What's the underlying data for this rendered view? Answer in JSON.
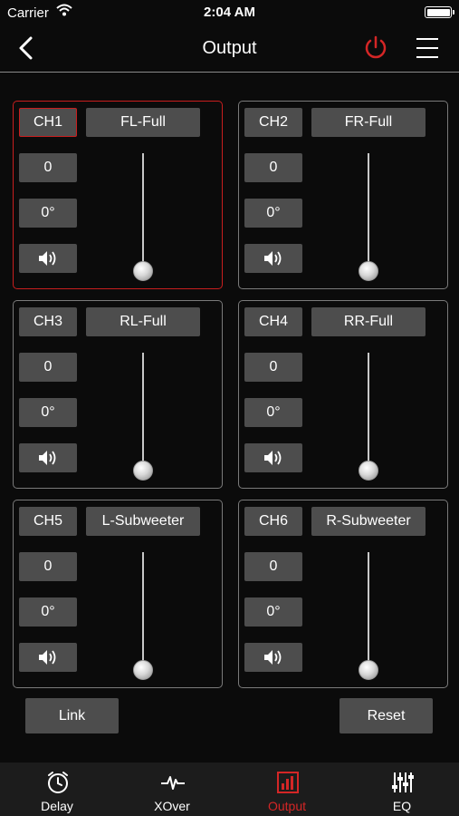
{
  "status": {
    "carrier": "Carrier",
    "time": "2:04 AM"
  },
  "nav": {
    "title": "Output"
  },
  "channels": [
    {
      "ch": "CH1",
      "mode": "FL-Full",
      "gain": "0",
      "phase": "0°",
      "level": 0
    },
    {
      "ch": "CH2",
      "mode": "FR-Full",
      "gain": "0",
      "phase": "0°",
      "level": 0
    },
    {
      "ch": "CH3",
      "mode": "RL-Full",
      "gain": "0",
      "phase": "0°",
      "level": 0
    },
    {
      "ch": "CH4",
      "mode": "RR-Full",
      "gain": "0",
      "phase": "0°",
      "level": 0
    },
    {
      "ch": "CH5",
      "mode": "L-Subweeter",
      "gain": "0",
      "phase": "0°",
      "level": 0
    },
    {
      "ch": "CH6",
      "mode": "R-Subweeter",
      "gain": "0",
      "phase": "0°",
      "level": 0
    }
  ],
  "actions": {
    "link": "Link",
    "reset": "Reset"
  },
  "tabs": [
    {
      "label": "Delay",
      "icon": "clock-icon"
    },
    {
      "label": "XOver",
      "icon": "waveform-icon"
    },
    {
      "label": "Output",
      "icon": "bar-chart-icon"
    },
    {
      "label": "EQ",
      "icon": "equalizer-sliders-icon"
    }
  ],
  "active_tab": "Output",
  "colors": {
    "accent": "#d42626",
    "button": "#4d4d4d",
    "background": "#0b0b0b"
  }
}
